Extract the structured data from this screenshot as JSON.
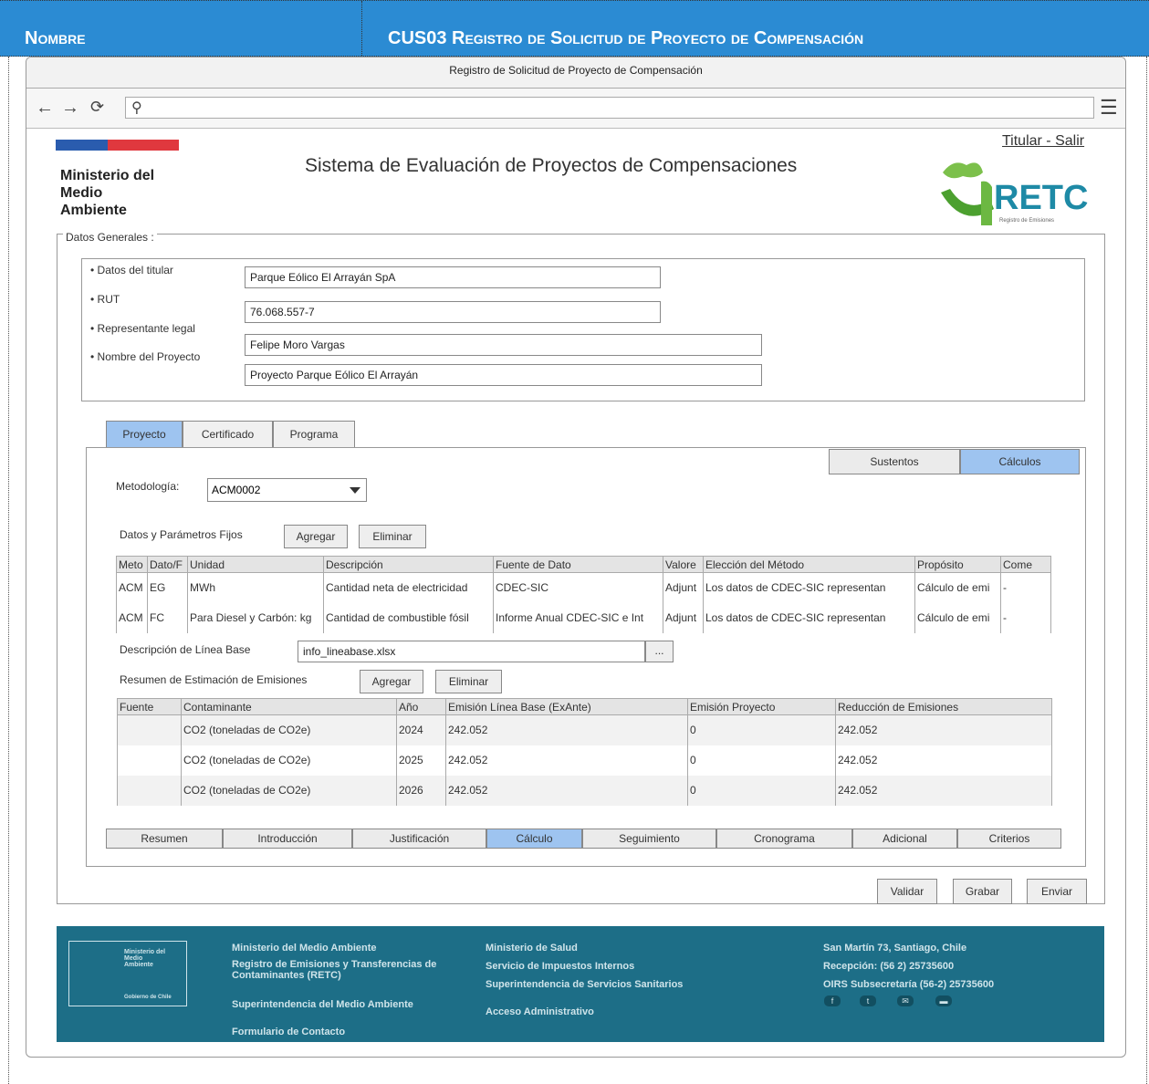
{
  "doc_header": {
    "left_label": "Nombre",
    "right_label": "CUS03 Registro de Solicitud de Proyecto de Compensación"
  },
  "browser": {
    "window_title": "Registro de Solicitud de Proyecto de Compensación",
    "back_icon": "←",
    "forward_icon": "→",
    "reload_icon": "⟳",
    "search_icon": "⚲",
    "menu_icon": "☰"
  },
  "header": {
    "ministry_line1": "Ministerio del",
    "ministry_line2": "Medio",
    "ministry_line3": "Ambiente",
    "system_title": "Sistema de Evaluación de Proyectos de Compensaciones",
    "user_link": "Titular - Salir",
    "logo_text": "RETC",
    "logo_subtext": "Registro de Emisiones"
  },
  "general": {
    "legend": "Datos Generales :",
    "labels": [
      "• Datos del titular",
      "• RUT",
      "• Representante legal",
      "• Nombre del Proyecto"
    ],
    "values": [
      "Parque Eólico El Arrayán SpA",
      "76.068.557-7",
      "Felipe Moro Vargas",
      "Proyecto Parque Eólico El Arrayán"
    ]
  },
  "tabs": {
    "items": [
      "Proyecto",
      "Certificado",
      "Programa"
    ],
    "sub_items": [
      "Sustentos",
      "Cálculos"
    ]
  },
  "methodology": {
    "label": "Metodología:",
    "value": "ACM0002"
  },
  "fixed_params": {
    "label": "Datos y Parámetros Fijos",
    "add_label": "Agregar",
    "delete_label": "Eliminar",
    "columns": [
      "Meto",
      "Dato/F",
      "Unidad",
      "Descripción",
      "Fuente de Dato",
      "Valore",
      "Elección del Método",
      "Propósito",
      "Come"
    ],
    "rows": [
      [
        "ACM",
        "EG",
        "MWh",
        "Cantidad neta de electricidad",
        "CDEC-SIC",
        "Adjunt",
        "Los datos de CDEC-SIC representan",
        "Cálculo de emi",
        "-"
      ],
      [
        "ACM",
        "FC",
        "Para Diesel y Carbón: kg",
        "Cantidad de combustible fósil",
        "Informe Anual CDEC-SIC e Int",
        "Adjunt",
        "Los datos de CDEC-SIC representan",
        "Cálculo de emi",
        "-"
      ]
    ]
  },
  "baseline": {
    "label": "Descripción de Línea Base",
    "file": "info_lineabase.xlsx",
    "browse_label": "..."
  },
  "emissions": {
    "label": "Resumen de Estimación de Emisiones",
    "add_label": "Agregar",
    "delete_label": "Eliminar",
    "columns": [
      "Fuente",
      "Contaminante",
      "Año",
      "Emisión Línea Base (ExAnte)",
      "Emisión Proyecto",
      "Reducción de Emisiones"
    ],
    "rows": [
      [
        "",
        "CO2 (toneladas de CO2e)",
        "2024",
        "242.052",
        "0",
        "242.052"
      ],
      [
        "",
        "CO2 (toneladas de CO2e)",
        "2025",
        "242.052",
        "0",
        "242.052"
      ],
      [
        "",
        "CO2 (toneladas de CO2e)",
        "2026",
        "242.052",
        "0",
        "242.052"
      ]
    ]
  },
  "section_tabs": [
    "Resumen",
    "Introducción",
    "Justificación",
    "Cálculo",
    "Seguimiento",
    "Cronograma",
    "Adicional",
    "Criterios"
  ],
  "actions": {
    "validate": "Validar",
    "save": "Grabar",
    "send": "Enviar"
  },
  "footer": {
    "logo_lines": [
      "Ministerio del",
      "Medio",
      "Ambiente",
      "Gobierno de Chile"
    ],
    "col1": [
      "Ministerio del Medio Ambiente",
      "Registro de Emisiones y Transferencias de Contaminantes (RETC)",
      "Superintendencia del Medio Ambiente",
      "Formulario de Contacto"
    ],
    "col2": [
      "Ministerio de Salud",
      "Servicio de Impuestos Internos",
      "Superintendencia de Servicios Sanitarios",
      "Acceso Administrativo"
    ],
    "col3": [
      "San Martín 73, Santiago, Chile",
      "Recepción: (56 2) 25735600",
      "OIRS Subsecretaría (56-2) 25735600"
    ],
    "social": [
      "f",
      "t",
      "✉",
      "▬"
    ]
  }
}
